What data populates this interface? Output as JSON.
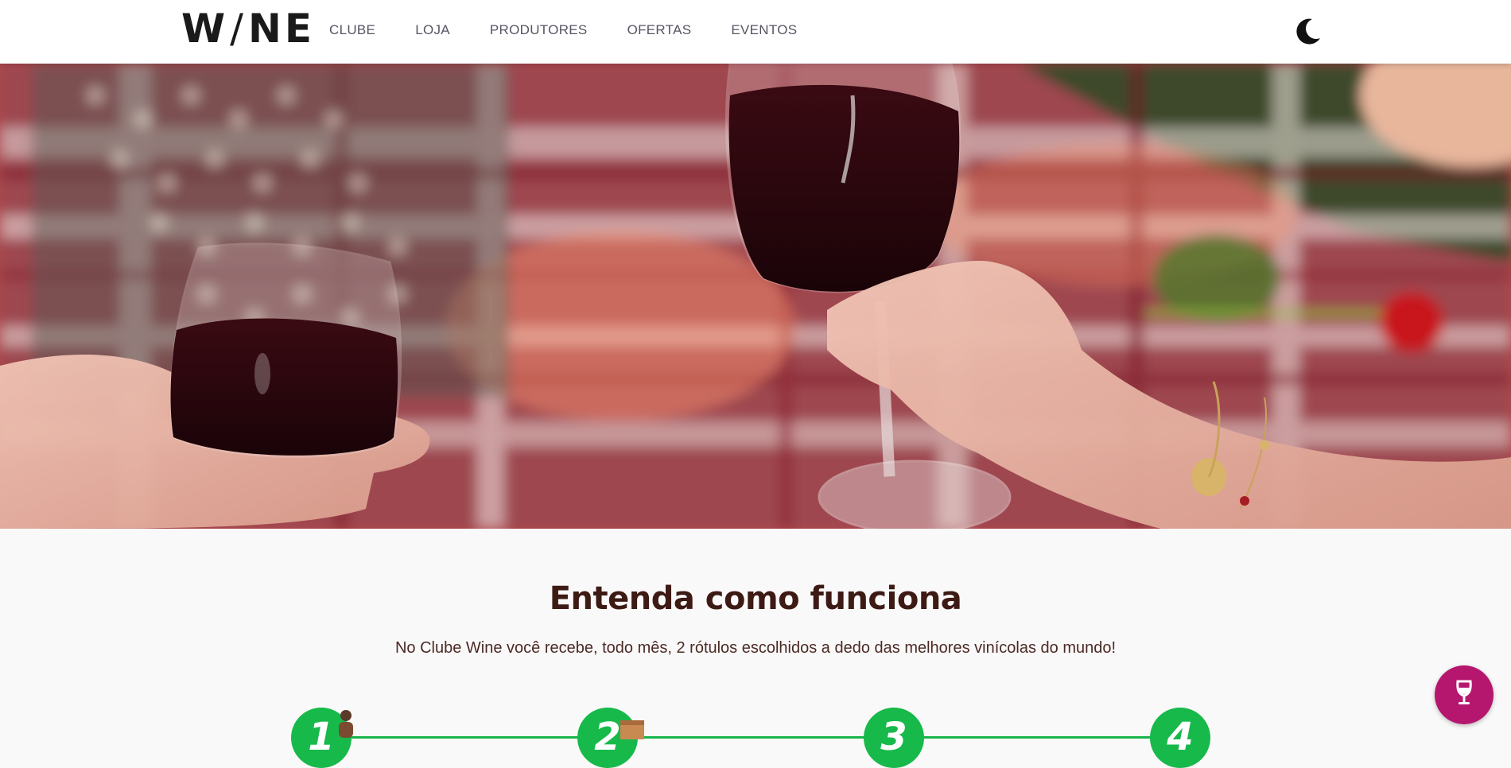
{
  "header": {
    "logo": {
      "left": "W",
      "slash": "/",
      "right": "NE"
    },
    "nav": [
      {
        "label": "CLUBE"
      },
      {
        "label": "LOJA"
      },
      {
        "label": "PRODUTORES"
      },
      {
        "label": "OFERTAS"
      },
      {
        "label": "EVENTOS"
      }
    ],
    "theme_toggle_icon": "moon-icon"
  },
  "hero": {
    "image": "picnic-wine-toast-photo"
  },
  "section": {
    "title": "Entenda como funciona",
    "subtitle": "No Clube Wine você recebe, todo mês, 2 rótulos escolhidos a dedo das melhores vinícolas do mundo!"
  },
  "steps": [
    {
      "number": "1",
      "icon": "person-icon"
    },
    {
      "number": "2",
      "icon": "box-icon"
    },
    {
      "number": "3",
      "icon": ""
    },
    {
      "number": "4",
      "icon": ""
    }
  ],
  "colors": {
    "accent_green": "#17b94b",
    "fab_magenta": "#b5176e",
    "title_brown": "#3d1a14"
  },
  "fab": {
    "icon": "wine-glass-icon"
  }
}
